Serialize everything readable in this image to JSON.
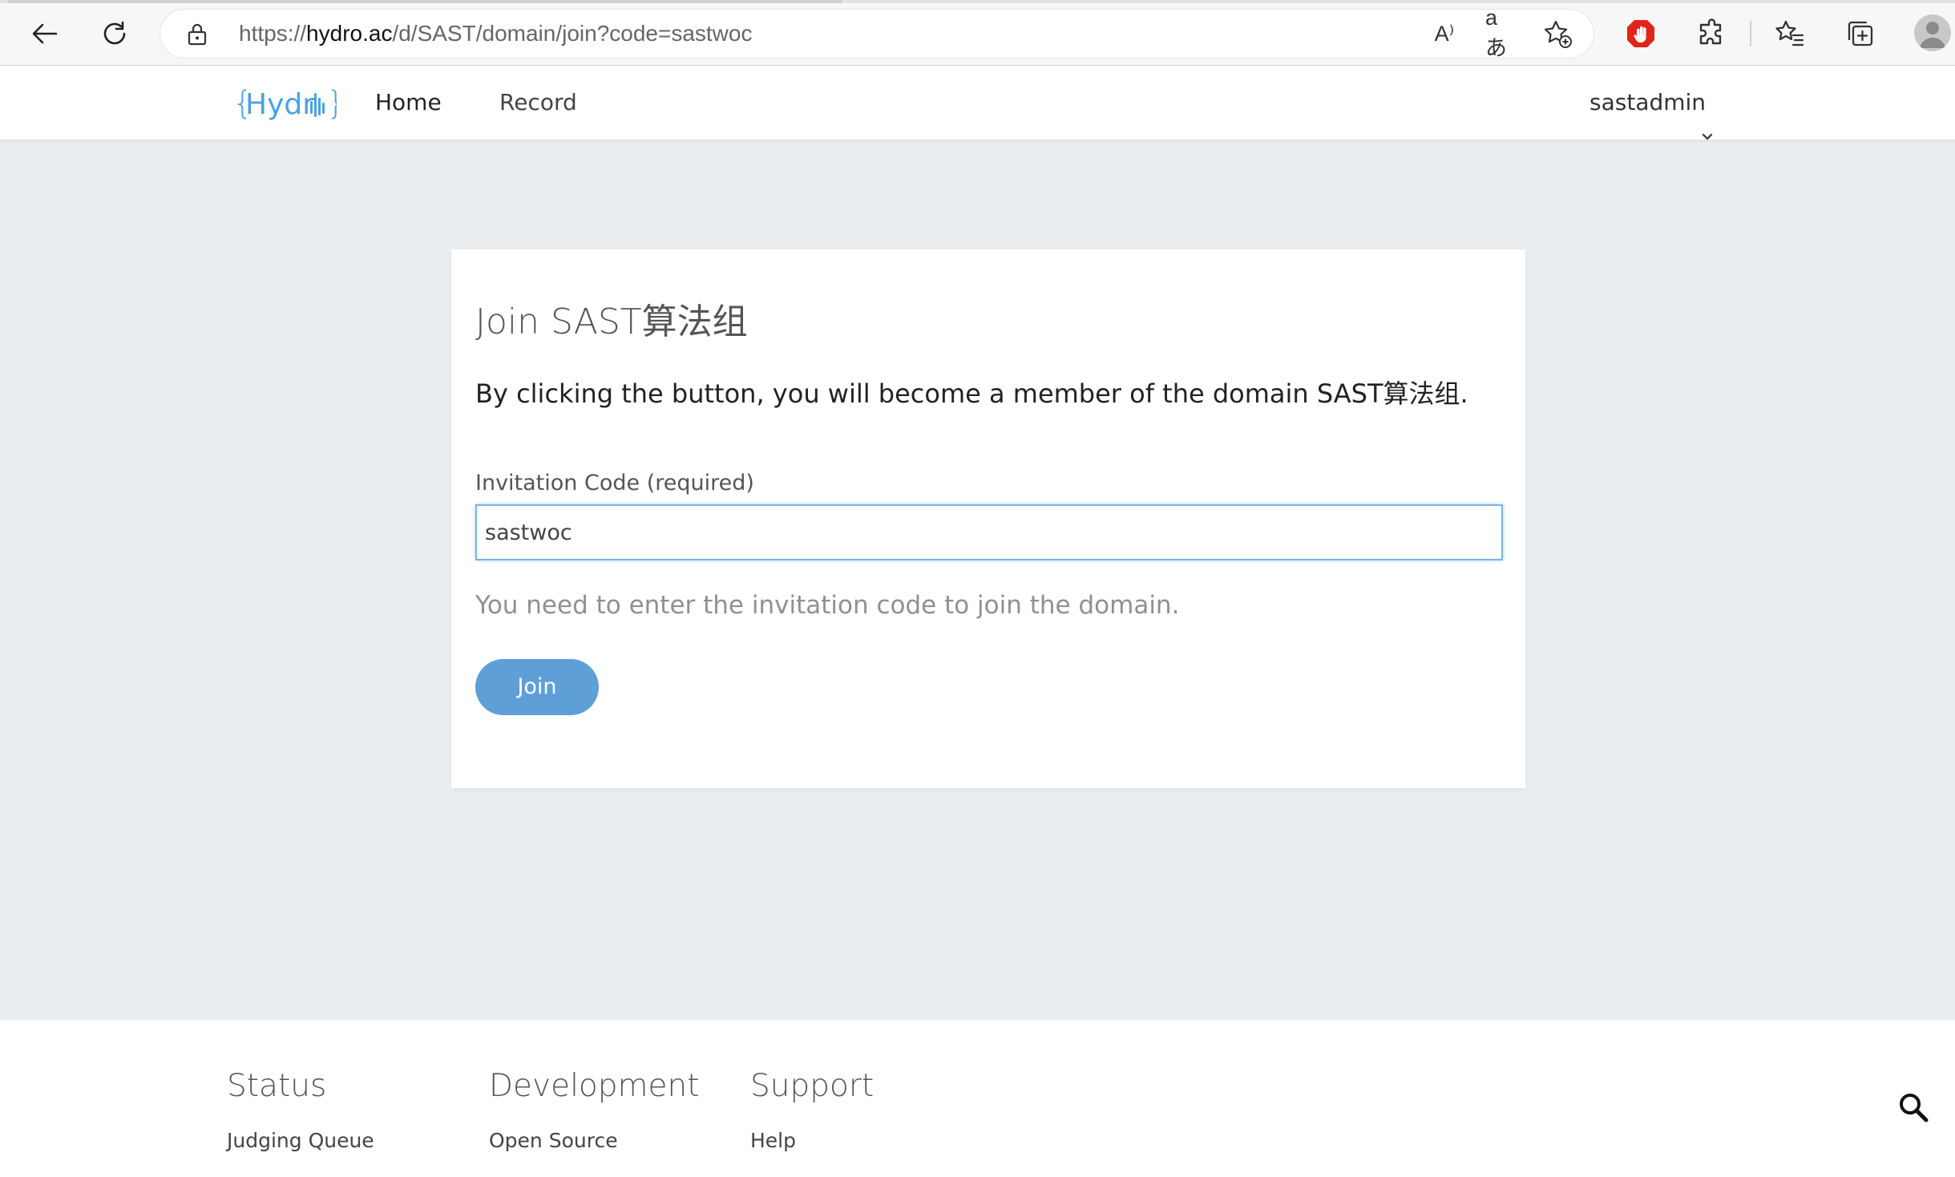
{
  "browser": {
    "url_prefix": "https://",
    "url_host": "hydro.ac",
    "url_path": "/d/SAST/domain/join?code=sastwoc",
    "read_aloud_label": "A⁾",
    "translate_label": "aあ"
  },
  "header": {
    "logo_text": "{Hydro}",
    "nav": [
      {
        "label": "Home"
      },
      {
        "label": "Record"
      }
    ],
    "username": "sastadmin"
  },
  "card": {
    "title": "Join SAST算法组",
    "description": "By clicking the button, you will become a member of the domain SAST算法组.",
    "field_label": "Invitation Code (required)",
    "field_value": "sastwoc",
    "help_text": "You need to enter the invitation code to join the domain.",
    "button_label": "Join"
  },
  "footer": {
    "columns": [
      {
        "heading": "Status",
        "links": [
          "Judging Queue"
        ]
      },
      {
        "heading": "Development",
        "links": [
          "Open Source"
        ]
      },
      {
        "heading": "Support",
        "links": [
          "Help"
        ]
      }
    ]
  },
  "colors": {
    "accent": "#5e9fd7",
    "page_bg": "#eaeef1",
    "logo": "#4aa3df",
    "adblock_red": "#e2231a"
  }
}
